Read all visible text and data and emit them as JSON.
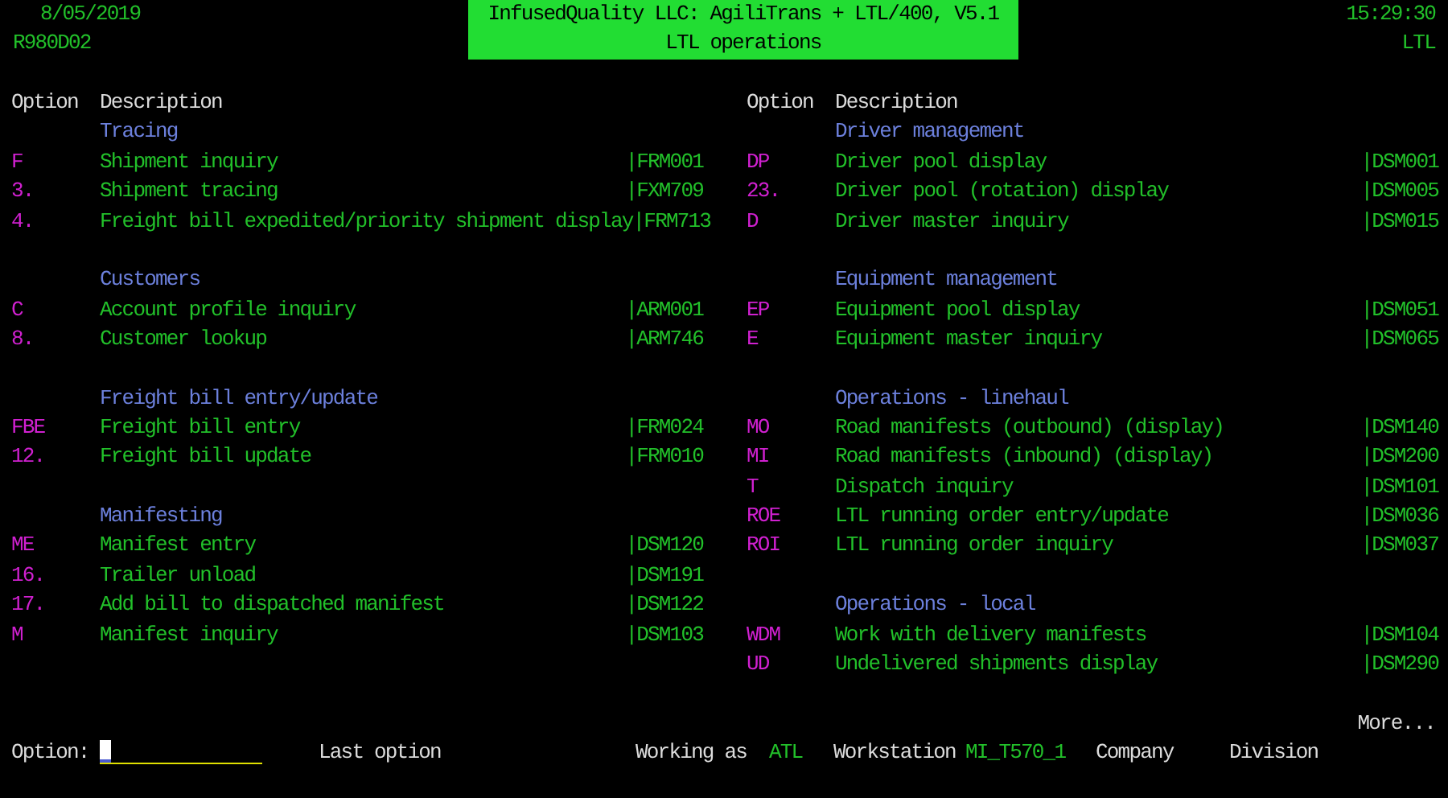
{
  "header": {
    "date": "8/05/2019",
    "screen_id": "R980D02",
    "title": "InfusedQuality LLC: AgiliTrans + LTL/400, V5.1",
    "subtitle": "LTL operations",
    "time": "15:29:30",
    "area": "LTL"
  },
  "columns": [
    {
      "option_heading": "Option",
      "description_heading": "Description",
      "sections": [
        {
          "heading": "Tracing",
          "items": [
            {
              "option": "F",
              "description": "Shipment inquiry",
              "program": "|FRM001"
            },
            {
              "option": "3.",
              "description": "Shipment tracing",
              "program": "|FXM709"
            },
            {
              "option": "4.",
              "description": "Freight bill expedited/priority shipment display",
              "program": "|FRM713"
            }
          ]
        },
        {
          "heading": "Customers",
          "items": [
            {
              "option": "C",
              "description": "Account profile inquiry",
              "program": "|ARM001"
            },
            {
              "option": "8.",
              "description": "Customer lookup",
              "program": "|ARM746"
            }
          ]
        },
        {
          "heading": "Freight bill entry/update",
          "items": [
            {
              "option": "FBE",
              "description": "Freight bill entry",
              "program": "|FRM024"
            },
            {
              "option": "12.",
              "description": "Freight bill update",
              "program": "|FRM010"
            }
          ]
        },
        {
          "heading": "Manifesting",
          "items": [
            {
              "option": "ME",
              "description": "Manifest entry",
              "program": "|DSM120"
            },
            {
              "option": "16.",
              "description": "Trailer unload",
              "program": "|DSM191"
            },
            {
              "option": "17.",
              "description": "Add bill to dispatched manifest",
              "program": "|DSM122"
            },
            {
              "option": "M",
              "description": "Manifest inquiry",
              "program": "|DSM103"
            }
          ]
        }
      ]
    },
    {
      "option_heading": "Option",
      "description_heading": "Description",
      "sections": [
        {
          "heading": "Driver management",
          "items": [
            {
              "option": "DP",
              "description": "Driver pool display",
              "program": "|DSM001"
            },
            {
              "option": "23.",
              "description": "Driver pool (rotation) display",
              "program": "|DSM005"
            },
            {
              "option": "D",
              "description": "Driver master inquiry",
              "program": "|DSM015"
            }
          ]
        },
        {
          "heading": "Equipment management",
          "items": [
            {
              "option": "EP",
              "description": "Equipment pool display",
              "program": "|DSM051"
            },
            {
              "option": "E",
              "description": "Equipment master inquiry",
              "program": "|DSM065"
            }
          ]
        },
        {
          "heading": "Operations - linehaul",
          "items": [
            {
              "option": "MO",
              "description": "Road manifests (outbound) (display)",
              "program": "|DSM140"
            },
            {
              "option": "MI",
              "description": "Road manifests (inbound) (display)",
              "program": "|DSM200"
            },
            {
              "option": "T",
              "description": "Dispatch inquiry",
              "program": "|DSM101"
            },
            {
              "option": "ROE",
              "description": "LTL running order entry/update",
              "program": "|DSM036"
            },
            {
              "option": "ROI",
              "description": "LTL running order inquiry",
              "program": "|DSM037"
            }
          ]
        },
        {
          "heading": "Operations - local",
          "items": [
            {
              "option": "WDM",
              "description": "Work with delivery manifests",
              "program": "|DSM104"
            },
            {
              "option": "UD",
              "description": "Undelivered shipments display",
              "program": "|DSM290"
            }
          ]
        }
      ]
    }
  ],
  "more": "More...",
  "footer": {
    "option_label": "Option:",
    "last_option_label": "Last option",
    "working_as_label": "Working as",
    "working_as": "ATL",
    "workstation_label": "Workstation",
    "workstation": "MI_T570_1",
    "company_label": "Company",
    "division_label": "Division"
  }
}
